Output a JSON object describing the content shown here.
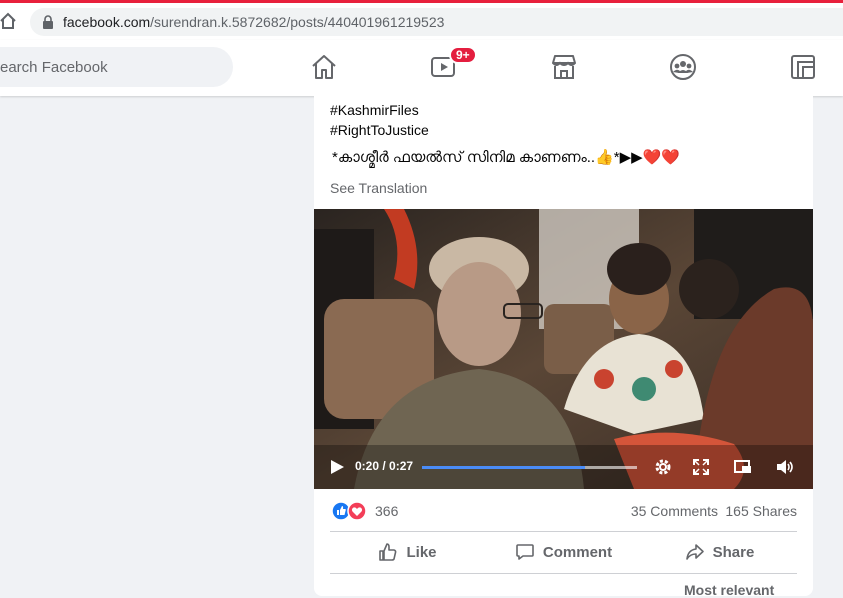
{
  "browser": {
    "url_domain": "facebook.com",
    "url_path": "/surendran.k.5872682/posts/440401961219523"
  },
  "header": {
    "search_placeholder": "Search Facebook",
    "search_visible_text": "earch Facebook",
    "nav": [
      {
        "icon": "home-icon"
      },
      {
        "icon": "watch-icon",
        "badge": "9+"
      },
      {
        "icon": "marketplace-icon"
      },
      {
        "icon": "groups-icon"
      },
      {
        "icon": "gaming-icon"
      }
    ]
  },
  "post": {
    "hashtags": [
      "#KashmirFiles",
      "#RightToJustice"
    ],
    "text": "*കാശ്മീർ ഫയൽസ് സിനിമ കാണണം..👍*▶▶❤️❤️",
    "see_translation": "See Translation",
    "video": {
      "time": "0:20 / 0:27",
      "progress": 0.757
    },
    "reactions": {
      "count": "366",
      "types": [
        "like-icon",
        "love-icon"
      ]
    },
    "comments": "35 Comments",
    "shares": "165 Shares",
    "actions": {
      "like": "Like",
      "comment": "Comment",
      "share": "Share"
    },
    "sort_label": "Most relevant"
  },
  "colors": {
    "accent_blue": "#1877f2",
    "badge_red": "#e41e3f",
    "progress_blue": "#4a8cf7"
  }
}
